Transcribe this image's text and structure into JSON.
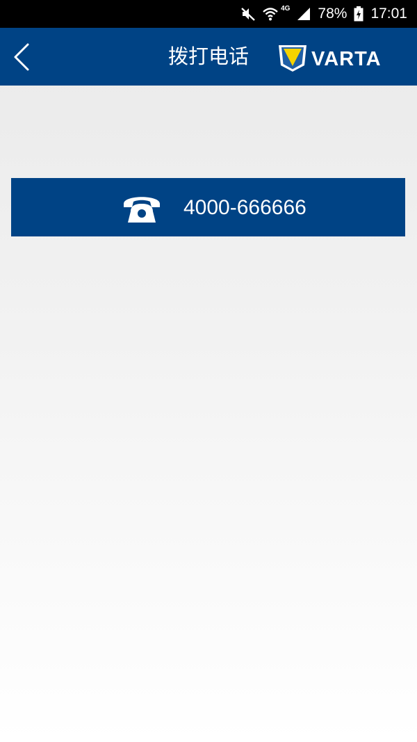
{
  "status_bar": {
    "network_label": "4G",
    "battery_percent": "78%",
    "time": "17:01",
    "icons": [
      "mute-icon",
      "wifi-icon",
      "signal-icon",
      "battery-charging-icon"
    ]
  },
  "header": {
    "back_icon": "chevron-left-icon",
    "title": "拨打电话",
    "logo_text": "VARTA",
    "colors": {
      "bar": "#004385",
      "logo_yellow": "#f6d300"
    }
  },
  "call": {
    "icon": "telephone-icon",
    "number": "4000-666666",
    "color": "#004385"
  }
}
